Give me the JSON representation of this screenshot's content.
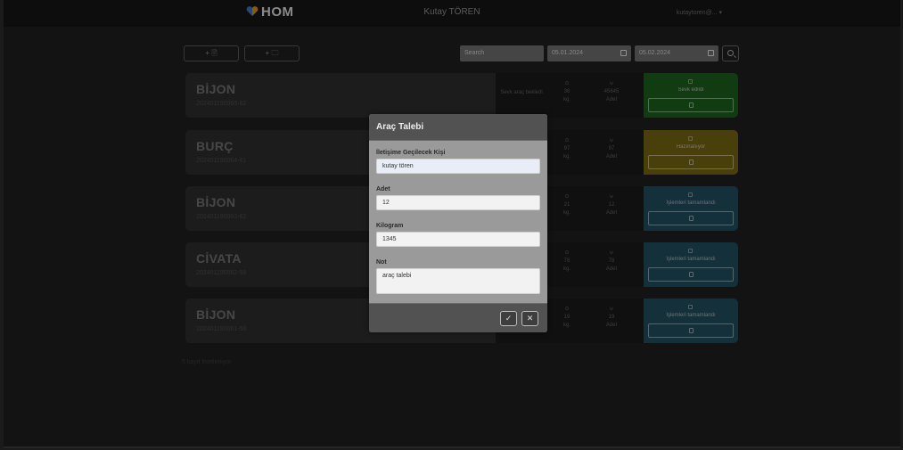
{
  "header": {
    "logo_text": "HOM",
    "center_user": "Kutay TÖREN",
    "user_menu": "kutaytoren@..."
  },
  "toolbar": {
    "add_button_1": "+ 🗎",
    "add_button_2": "+ 🗀",
    "search_placeholder": "Search",
    "date_from": "05.01.2024",
    "date_to": "05.02.2024"
  },
  "cards": [
    {
      "title": "BİJON",
      "code": "202401190065-62",
      "stat1_value": "",
      "stat1_unit": "",
      "stat2_value": "36",
      "stat2_unit": "kg.",
      "stat3_value": "45645",
      "stat3_unit": "Adet",
      "status_label": "Sevk edildi"
    },
    {
      "title": "BURÇ",
      "code": "202401190064-61",
      "stat2_value": "97",
      "stat2_unit": "kg.",
      "stat3_value": "97",
      "stat3_unit": "Adet",
      "status_label": "Hazırlanıyor"
    },
    {
      "title": "BİJON",
      "code": "202401190063-62",
      "stat2_value": "21",
      "stat2_unit": "kg.",
      "stat3_value": "12",
      "stat3_unit": "Adet",
      "status_label": "İşlemleri tamamlandı"
    },
    {
      "title": "CİVATA",
      "code": "202401190062-58",
      "stat2_value": "78",
      "stat2_unit": "kg.",
      "stat3_value": "78",
      "stat3_unit": "Adet",
      "status_label": "İşlemleri tamamlandı"
    },
    {
      "title": "BİJON",
      "code": "202401190061-58",
      "stat2_value": "19",
      "stat2_unit": "kg.",
      "stat3_value": "19",
      "stat3_unit": "Adet",
      "status_label": "İşlemleri tamamlandı"
    }
  ],
  "first_card_stat_label": "Sevk araç bekledi",
  "footer_count": "5 kayıt listeleniyor",
  "modal": {
    "title": "Araç Talebi",
    "contact_label": "İletişime Geçilecek Kişi",
    "contact_value": "kutay tören",
    "quantity_label": "Adet",
    "quantity_value": "12",
    "weight_label": "Kilogram",
    "weight_value": "1345",
    "note_label": "Not",
    "note_value": "araç talebi",
    "confirm_label": "✓",
    "cancel_label": "✕"
  },
  "colors": {
    "status_green": "#1b5d1d",
    "status_yellow": "#6f6212",
    "status_blue": "#1f4a5a",
    "logo_heart_left": "#3a6fb5",
    "logo_heart_right": "#d48a1a"
  }
}
